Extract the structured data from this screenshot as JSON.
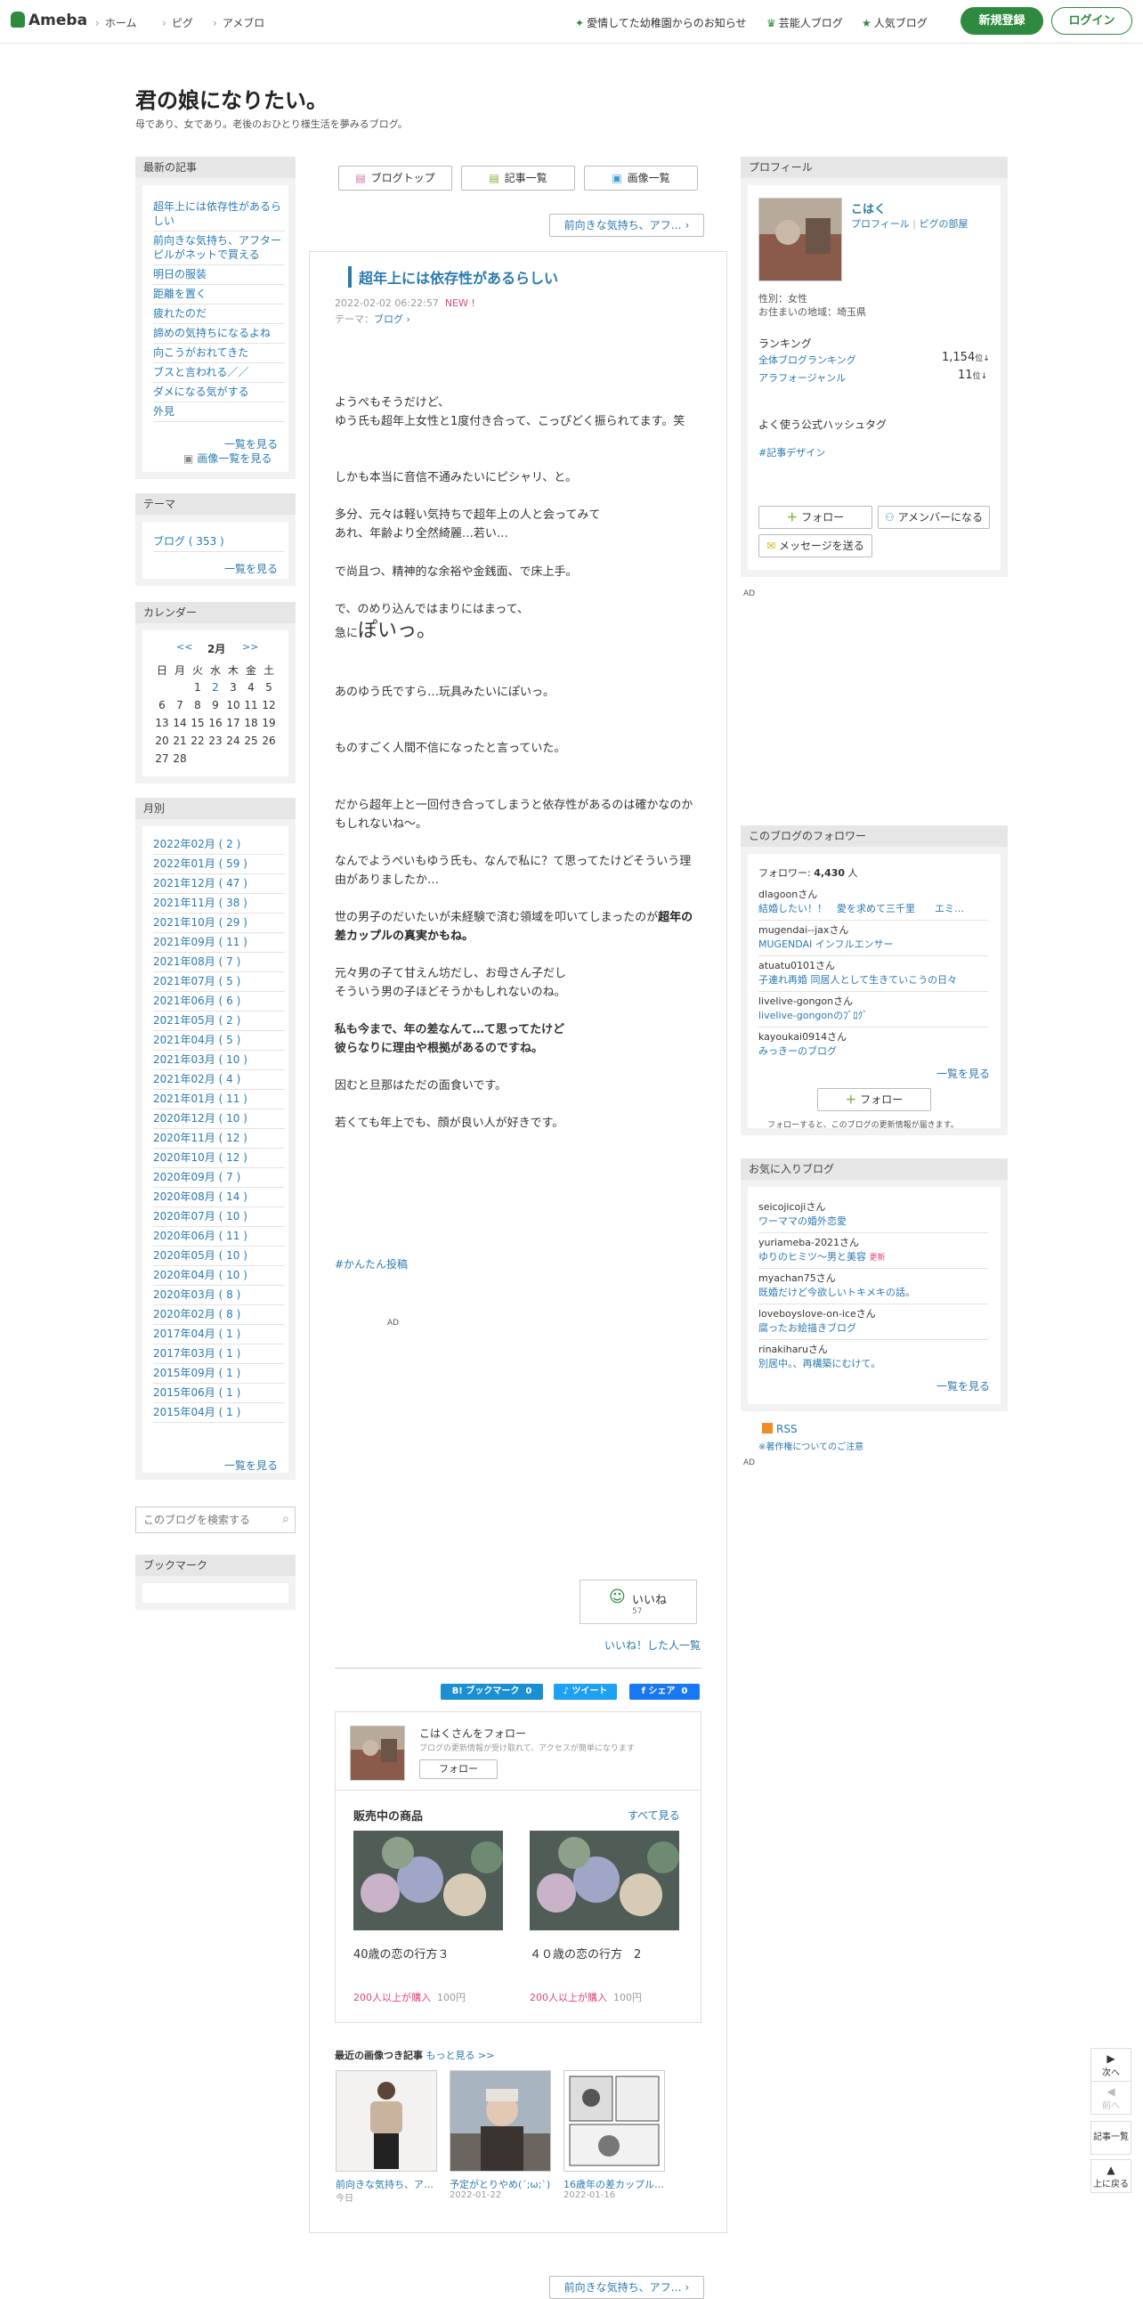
{
  "header": {
    "logo": "Ameba",
    "crumbs": [
      "ホーム",
      "ピグ",
      "アメブロ"
    ],
    "links": [
      "愛情してた幼稚園からのお知らせ",
      "芸能人ブログ",
      "人気ブログ"
    ],
    "register": "新規登録",
    "login": "ログイン"
  },
  "blog": {
    "title": "君の娘になりたい。",
    "description": "母であり、女であり。老後のおひとり様生活を夢みるブログ。"
  },
  "left": {
    "recent_title": "最新の記事",
    "recent": [
      "超年上には依存性があるらしい",
      "前向きな気持ち、アフターピルがネットで買える",
      "明日の服装",
      "距離を置く",
      "疲れたのだ",
      "諦めの気持ちになるよね",
      "向こうがおれてきた",
      "ブスと言われる／／",
      "ダメになる気がする",
      "外見"
    ],
    "recent_more": "一覧を見る",
    "recent_images": "画像一覧を見る",
    "theme_title": "テーマ",
    "theme_item": "ブログ ( 353 )",
    "theme_more": "一覧を見る",
    "calendar_title": "カレンダー",
    "cal_prev": "<<",
    "cal_month": "2月",
    "cal_next": ">>",
    "cal_days": [
      "日",
      "月",
      "火",
      "水",
      "木",
      "金",
      "土"
    ],
    "cal_rows": [
      [
        "",
        "",
        "1",
        "2",
        "3",
        "4",
        "5"
      ],
      [
        "6",
        "7",
        "8",
        "9",
        "10",
        "11",
        "12"
      ],
      [
        "13",
        "14",
        "15",
        "16",
        "17",
        "18",
        "19"
      ],
      [
        "20",
        "21",
        "22",
        "23",
        "24",
        "25",
        "26"
      ],
      [
        "27",
        "28",
        "",
        "",
        "",
        "",
        ""
      ]
    ],
    "monthly_title": "月別",
    "monthly": [
      "2022年02月 ( 2 )",
      "2022年01月 ( 59 )",
      "2021年12月 ( 47 )",
      "2021年11月 ( 38 )",
      "2021年10月 ( 29 )",
      "2021年09月 ( 11 )",
      "2021年08月 ( 7 )",
      "2021年07月 ( 5 )",
      "2021年06月 ( 6 )",
      "2021年05月 ( 2 )",
      "2021年04月 ( 5 )",
      "2021年03月 ( 10 )",
      "2021年02月 ( 4 )",
      "2021年01月 ( 11 )",
      "2020年12月 ( 10 )",
      "2020年11月 ( 12 )",
      "2020年10月 ( 12 )",
      "2020年09月 ( 7 )",
      "2020年08月 ( 14 )",
      "2020年07月 ( 10 )",
      "2020年06月 ( 11 )",
      "2020年05月 ( 10 )",
      "2020年04月 ( 10 )",
      "2020年03月 ( 8 )",
      "2020年02月 ( 8 )",
      "2017年04月 ( 1 )",
      "2017年03月 ( 1 )",
      "2015年09月 ( 1 )",
      "2015年06月 ( 1 )",
      "2015年04月 ( 1 )"
    ],
    "monthly_more": "一覧を見る",
    "search_placeholder": "このブログを検索する",
    "bookmark_title": "ブックマーク"
  },
  "main": {
    "nav": [
      "ブログトップ",
      "記事一覧",
      "画像一覧"
    ],
    "next_top": "前向きな気持ち、アフ…",
    "title": "超年上には依存性があるらしい",
    "date": "2022-02-02 06:22:57",
    "new": "NEW !",
    "theme_label": "テーマ：",
    "theme": "ブログ",
    "p1": "ようぺもそうだけど、",
    "p2": "ゆう氏も超年上女性と1度付き合って、こっぴどく振られてます。笑",
    "p3": "しかも本当に音信不通みたいにピシャリ、と。",
    "p4": "多分、元々は軽い気持ちで超年上の人と会ってみて",
    "p5": "あれ、年齢より全然綺麗…若い…",
    "p6": "で尚且つ、精神的な余裕や金銭面、で床上手。",
    "p7": "で、のめり込んではまりにはまって、",
    "p8a": "急に",
    "p8b": "ぽいっ。",
    "p9": "あのゆう氏ですら…玩具みたいにぽいっ。",
    "p10": "ものすごく人間不信になったと言っていた。",
    "p11": "だから超年上と一回付き合ってしまうと依存性があるのは確かなのかもしれないね〜。",
    "p12": "なんでようぺいもゆう氏も、なんで私に？て思ってたけどそういう理由がありましたか…",
    "p13a": "世の男子のだいたいが未経験で済む領域を叩いてしまったのが",
    "p13b": "超年の差カップルの真実かもね。",
    "p14": "元々男の子て甘えん坊だし、お母さん子だし",
    "p15": "そういう男の子ほどそうかもしれないのね。",
    "p16": "私も今まで、年の差なんて…て思ってたけど",
    "p17": "彼らなりに理由や根拠があるのですね。",
    "p18": "因むと旦那はただの面食いです。",
    "p19": "若くても年上でも、顔が良い人が好きです。",
    "hashtag": "#かんたん投稿",
    "ad": "AD",
    "like_label": "いいね",
    "like_count": "57",
    "like_list": "いいね！した人一覧",
    "share_bookmark": "B! ブックマーク",
    "share_bookmark_count": "0",
    "share_tweet": "ツイート",
    "share_fb": "シェア",
    "share_fb_count": "0",
    "follow_title": "こはくさんをフォロー",
    "follow_desc": "ブログの更新情報が受け取れて、アクセスが簡単になります",
    "follow_btn": "フォロー",
    "shop_title": "販売中の商品",
    "shop_all": "すべて見る",
    "products": [
      {
        "name": "40歳の恋の行方３",
        "buyers": "200人以上が購入",
        "price": "100円"
      },
      {
        "name": "４０歳の恋の行方　2",
        "buyers": "200人以上が購入",
        "price": "100円"
      }
    ],
    "recent_img_title": "最近の画像つき記事",
    "recent_img_more": "もっと見る >>",
    "recent_imgs": [
      {
        "title": "前向きな気持ち、ア…",
        "date": "今日"
      },
      {
        "title": "予定がとりやめ(´;ω;`)",
        "date": "2022-01-22"
      },
      {
        "title": "16歳年の差カップル…",
        "date": "2022-01-16"
      }
    ],
    "next_bottom": "前向きな気持ち、アフ…"
  },
  "right": {
    "profile_title": "プロフィール",
    "name": "こはく",
    "profile_link": "プロフィール",
    "pig_link": "ピグの部屋",
    "gender": "性別：女性",
    "area": "お住まいの地域：埼玉県",
    "ranking_title": "ランキング",
    "rank1_label": "全体ブログランキング",
    "rank1_value": "1,154",
    "rank2_label": "アラフォージャンル",
    "rank2_value": "11",
    "rank_unit": "位",
    "hashtag_title": "よく使う公式ハッシュタグ",
    "hashtag": "#記事デザイン",
    "follow_btn": "フォロー",
    "member_btn": "アメンバーになる",
    "message_btn": "メッセージを送る",
    "ad": "AD",
    "followers_title": "このブログのフォロワー",
    "followers_label": "フォロワー:",
    "followers_count": "4,430",
    "followers_unit": "人",
    "followers": [
      {
        "user": "dlagoon",
        "blog": "結婚したい！！　愛を求めて三千里　　エミ…"
      },
      {
        "user": "mugendai--jax",
        "blog": "MUGENDAI インフルエンサー"
      },
      {
        "user": "atuatu0101",
        "blog": "子連れ再婚 同居人として生きていこうの日々"
      },
      {
        "user": "livelive-gongon",
        "blog": "livelive-gongonのﾌﾞﾛｸﾞ"
      },
      {
        "user": "kayoukai0914",
        "blog": "みっきーのブログ"
      }
    ],
    "san": "さん",
    "followers_more": "一覧を見る",
    "follow_btn2": "フォロー",
    "follow_note": "フォローすると、このブログの更新情報が届きます。",
    "fav_title": "お気に入りブログ",
    "favs": [
      {
        "user": "seicojicoji",
        "blog": "ワーママの婚外恋愛",
        "updated": ""
      },
      {
        "user": "yuriameba-2021",
        "blog": "ゆりのヒミツ〜男と美容",
        "updated": "更新"
      },
      {
        "user": "myachan75",
        "blog": "既婚だけど今欲しいトキメキの話。",
        "updated": ""
      },
      {
        "user": "loveboyslove-on-ice",
        "blog": "腐ったお絵描きブログ",
        "updated": ""
      },
      {
        "user": "rinakiharu",
        "blog": "別居中。、再構築にむけて。",
        "updated": ""
      }
    ],
    "fav_more": "一覧を見る",
    "rss": "RSS",
    "copyright": "※著作権についてのご注意",
    "ad2": "AD"
  },
  "vnav": {
    "next": "次へ",
    "prev": "前へ",
    "list": "記事一覧",
    "top": "上に戻る"
  }
}
